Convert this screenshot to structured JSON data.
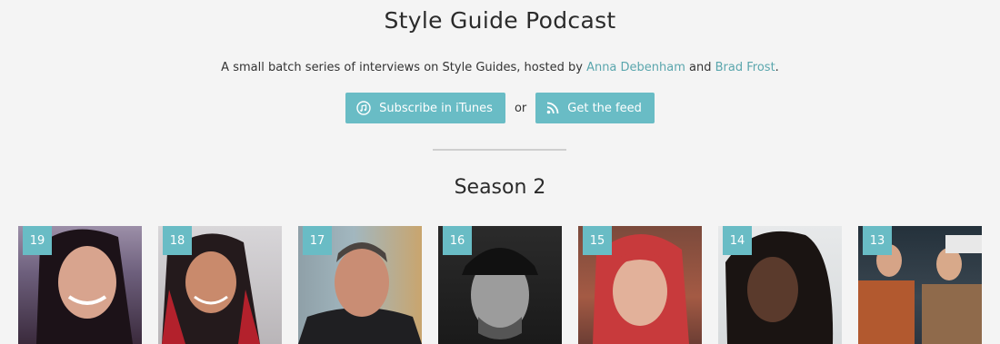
{
  "header": {
    "title": "Style Guide Podcast",
    "intro_prefix": "A small batch series of interviews on Style Guides, hosted by ",
    "host1": "Anna Debenham",
    "intro_and": " and ",
    "host2": "Brad Frost",
    "intro_suffix": "."
  },
  "actions": {
    "subscribe_label": "Subscribe in iTunes",
    "subscribe_icon": "itunes-icon",
    "or_text": "or",
    "feed_label": "Get the feed",
    "feed_icon": "rss-icon"
  },
  "season": {
    "title": "Season 2"
  },
  "episodes": [
    {
      "number": "19"
    },
    {
      "number": "18"
    },
    {
      "number": "17"
    },
    {
      "number": "16"
    },
    {
      "number": "15"
    },
    {
      "number": "14"
    },
    {
      "number": "13"
    }
  ],
  "colors": {
    "accent": "#69bcc5",
    "link": "#5aa6ad",
    "background": "#f4f4f4"
  }
}
